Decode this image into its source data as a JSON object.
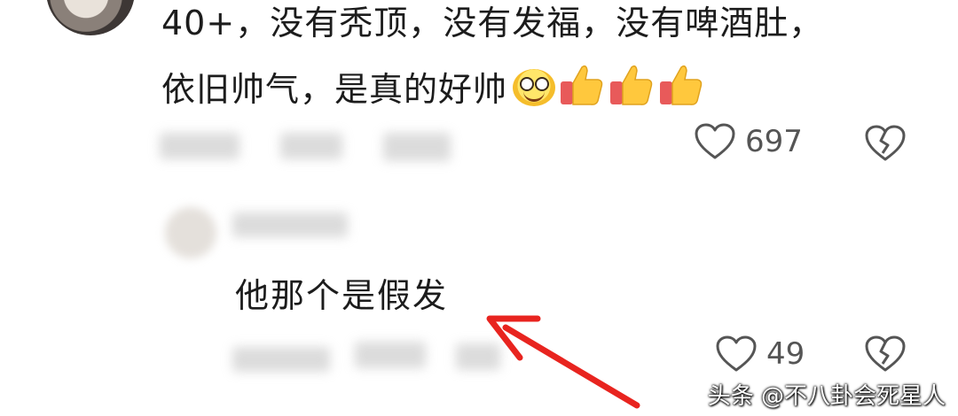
{
  "comment": {
    "line1": "40+，没有秃顶，没有发福，没有啤酒肚，",
    "line2": "依旧帅气，是真的好帅",
    "emojis": [
      "grinning-face-emoji",
      "thumbs-up-emoji",
      "thumbs-up-emoji",
      "thumbs-up-emoji"
    ],
    "likes": "697"
  },
  "reply": {
    "text": "他那个是假发",
    "likes": "49"
  },
  "annotation": {
    "arrow_color": "#e8241f"
  },
  "watermark": "头条 @不八卦会死星人"
}
